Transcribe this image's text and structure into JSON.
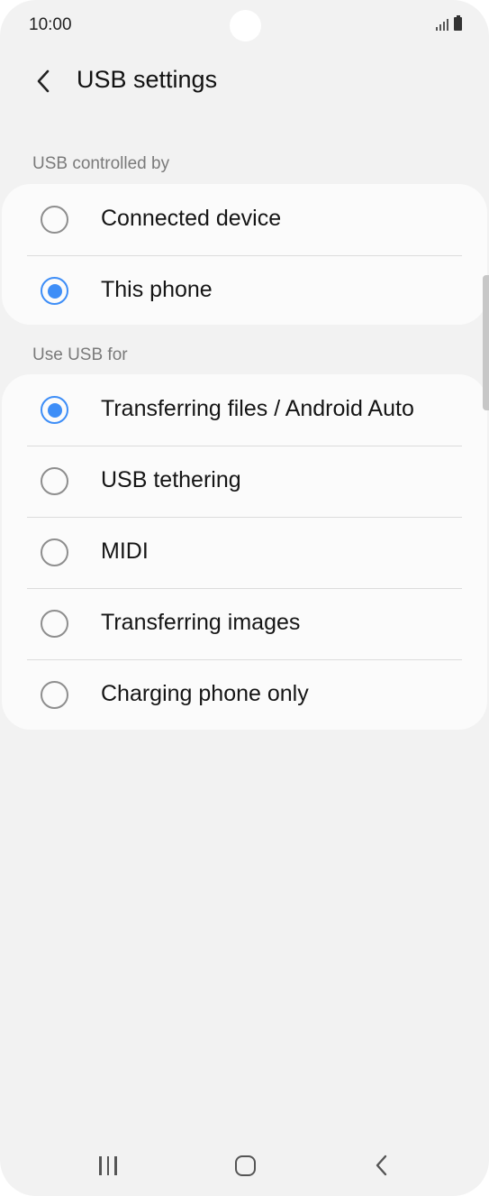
{
  "status_bar": {
    "time": "10:00"
  },
  "header": {
    "title": "USB settings"
  },
  "sections": {
    "controlled_by": {
      "label": "USB controlled by",
      "options": [
        {
          "label": "Connected device",
          "selected": false
        },
        {
          "label": "This phone",
          "selected": true
        }
      ]
    },
    "use_usb_for": {
      "label": "Use USB for",
      "options": [
        {
          "label": "Transferring files / Android Auto",
          "selected": true
        },
        {
          "label": "USB tethering",
          "selected": false
        },
        {
          "label": "MIDI",
          "selected": false
        },
        {
          "label": "Transferring images",
          "selected": false
        },
        {
          "label": "Charging phone only",
          "selected": false
        }
      ]
    }
  },
  "colors": {
    "accent": "#3e8ef7",
    "background": "#f2f2f2",
    "card": "#fbfbfb"
  },
  "nav": {
    "recent": "recent-apps-icon",
    "home": "home-icon",
    "back": "back-icon"
  }
}
